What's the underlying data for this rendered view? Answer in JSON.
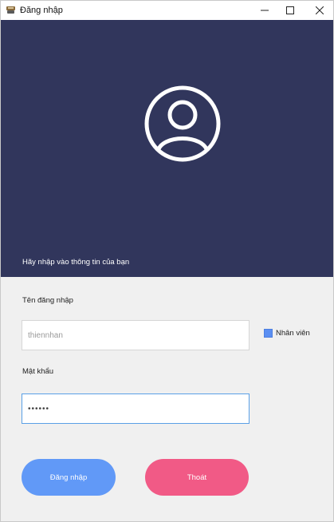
{
  "window": {
    "title": "Đăng nhập"
  },
  "banner": {
    "background": "#31365c",
    "avatar_icon": "user-circle-icon",
    "prompt": "Hãy nhập vào thông tin của bạn"
  },
  "form": {
    "username_label": "Tên đăng nhập",
    "username_value": "thiennhan",
    "password_label": "Mật khẩu",
    "password_value": "••••••",
    "role_checkbox_label": "Nhân viên",
    "role_checkbox_checked": true
  },
  "buttons": {
    "login_label": "Đăng nhập",
    "login_color": "#6199f7",
    "exit_label": "Thoát",
    "exit_color": "#f15a86"
  }
}
